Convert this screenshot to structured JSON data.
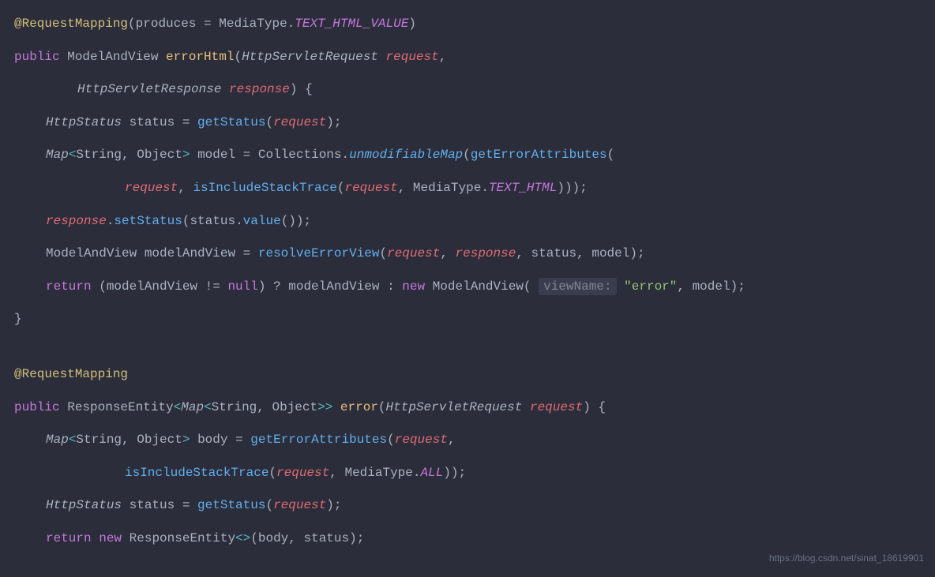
{
  "watermark": "https://blog.csdn.net/sinat_18619901",
  "code": {
    "annotation1": "@RequestMapping",
    "produces_key": "produces",
    "mediatype": "MediaType",
    "text_html_value": "TEXT_HTML_VALUE",
    "public": "public",
    "return_kw": "return",
    "new_kw": "new",
    "null_kw": "null",
    "modelandview": "ModelAndView",
    "errorhtml": "errorHtml",
    "httpservletrequest": "HttpServletRequest",
    "request": "request",
    "httpservletresponse": "HttpServletResponse",
    "response": "response",
    "httpstatus": "HttpStatus",
    "status": "status",
    "getstatus": "getStatus",
    "map": "Map",
    "string_t": "String",
    "object_t": "Object",
    "model": "model",
    "collections": "Collections",
    "unmodifiablemap": "unmodifiableMap",
    "geterrorattributes": "getErrorAttributes",
    "isincludestacktrace": "isIncludeStackTrace",
    "text_html": "TEXT_HTML",
    "setstatus": "setStatus",
    "value_method": "value",
    "modelandview_var": "modelAndView",
    "resolveerrorview": "resolveErrorView",
    "viewname_hint": "viewName:",
    "error_str": "\"error\"",
    "responseentity": "ResponseEntity",
    "error_method": "error",
    "body": "body",
    "all": "ALL"
  }
}
